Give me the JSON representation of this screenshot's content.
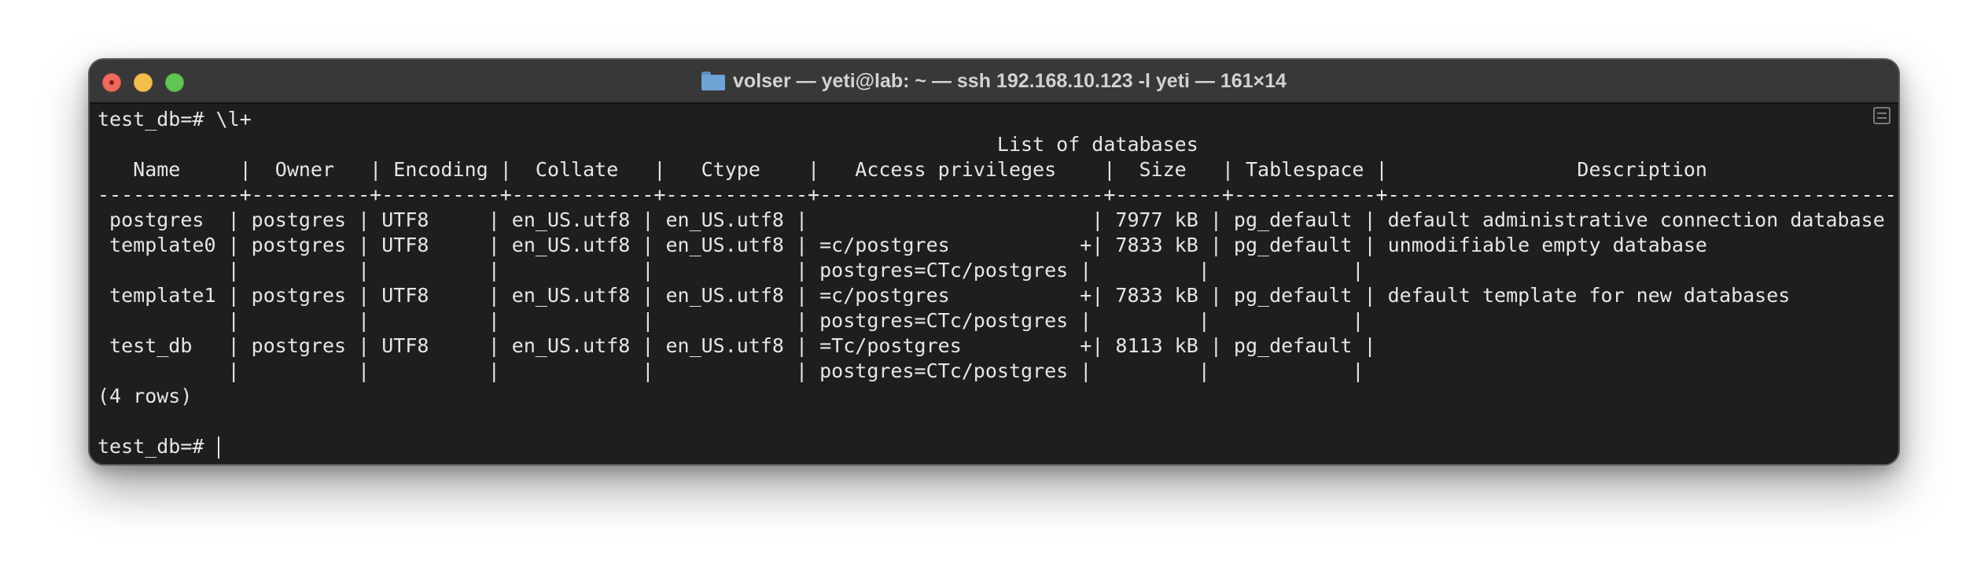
{
  "window": {
    "title": "volser — yeti@lab: ~ — ssh 192.168.10.123 -l yeti — 161×14",
    "title_icon": "folder-icon"
  },
  "terminal": {
    "lines": [
      "test_db=# \\l+",
      "                                                                            List of databases",
      "   Name     |  Owner   | Encoding |  Collate   |   Ctype    |   Access privileges    |  Size   | Tablespace |                Description",
      "------------+----------+----------+------------+------------+------------------------+---------+------------+--------------------------------------------",
      " postgres  | postgres | UTF8     | en_US.utf8 | en_US.utf8 |                        | 7977 kB | pg_default | default administrative connection database",
      " template0 | postgres | UTF8     | en_US.utf8 | en_US.utf8 | =c/postgres           +| 7833 kB | pg_default | unmodifiable empty database",
      "           |          |          |            |            | postgres=CTc/postgres |         |            |",
      " template1 | postgres | UTF8     | en_US.utf8 | en_US.utf8 | =c/postgres           +| 7833 kB | pg_default | default template for new databases",
      "           |          |          |            |            | postgres=CTc/postgres |         |            |",
      " test_db   | postgres | UTF8     | en_US.utf8 | en_US.utf8 | =Tc/postgres          +| 8113 kB | pg_default |",
      "           |          |          |            |            | postgres=CTc/postgres |         |            |",
      "(4 rows)",
      "",
      "test_db=# "
    ]
  },
  "colors": {
    "window_bg": "#1e1e1e",
    "titlebar_bg": "#383838",
    "text": "#e6e6e6",
    "close": "#ed6a5e",
    "minimize": "#f4be4f",
    "zoom": "#61c554"
  }
}
